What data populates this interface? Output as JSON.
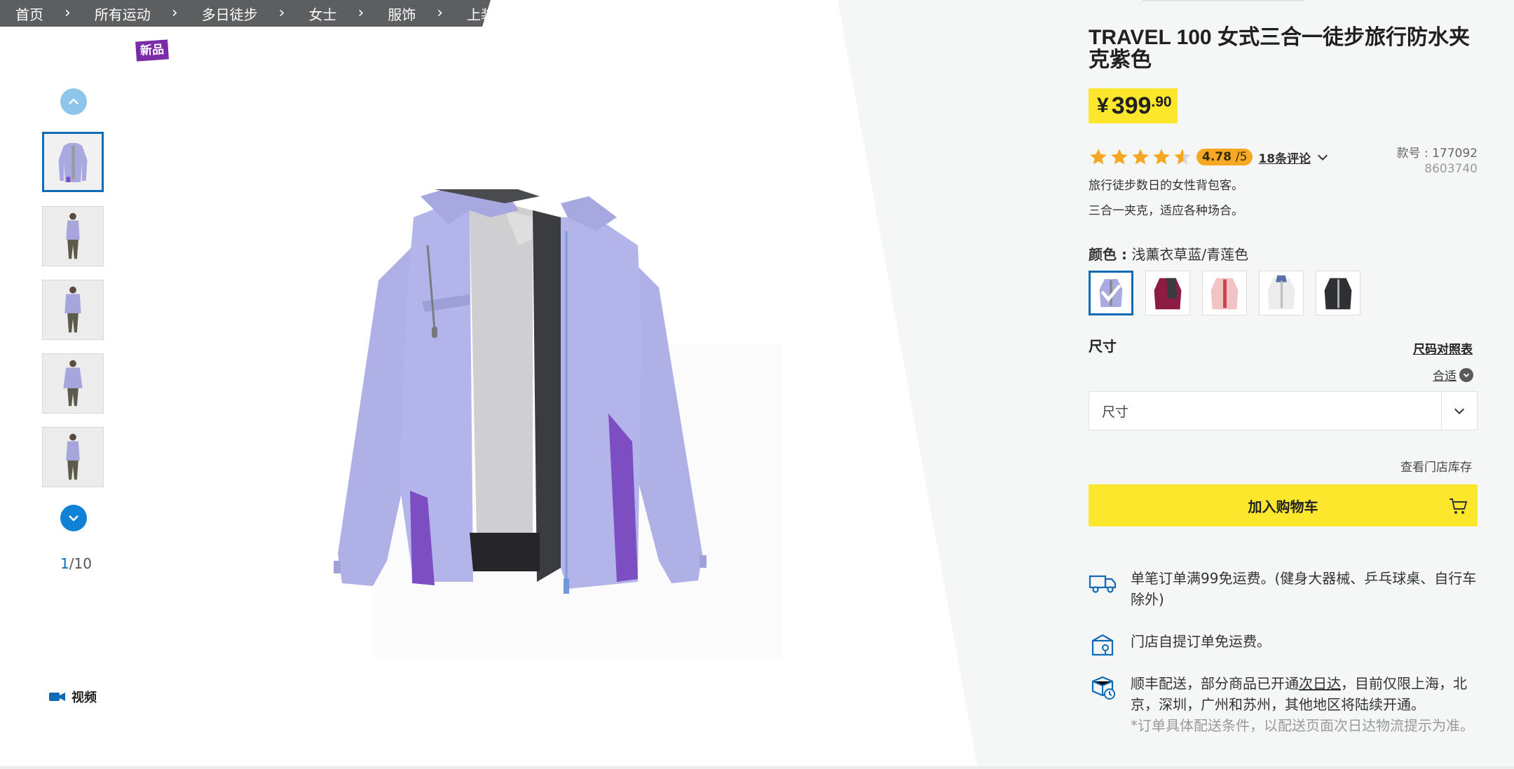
{
  "breadcrumb": [
    "首页",
    "所有运动",
    "多日徒步",
    "女士",
    "服饰",
    "上装"
  ],
  "badge": "新品",
  "gallery": {
    "current": "1",
    "separator": "/",
    "total": "10",
    "video_label": "视频"
  },
  "product": {
    "title": "TRAVEL 100 女式三合一徒步旅行防水夹克紫色",
    "price": {
      "currency": "¥",
      "integer": "399",
      "decimal": ".90"
    },
    "rating": {
      "value": "4.78",
      "scale": "/5",
      "stars": 4.78,
      "reviews_label": "18条评论"
    },
    "sku_label": "款号 : 177092",
    "sku_sub": "8603740",
    "desc1": "旅行徒步数日的女性背包客。",
    "desc2": "三合一夹克，适应各种场合。",
    "color_label": "颜色 :",
    "color_value": "浅薰衣草蓝/青莲色",
    "size_label": "尺寸",
    "size_chart": "尺码对照表",
    "fit_label": "合适",
    "size_placeholder": "尺寸",
    "store_stock": "查看门店库存",
    "add_to_cart": "加入购物车"
  },
  "shipping": [
    {
      "text": "单笔订单满99免运费。(健身大器械、乒乓球桌、自行车除外)",
      "icon": "truck-icon"
    },
    {
      "text": "门店自提订单免运费。",
      "icon": "store-pickup-icon"
    },
    {
      "text_a": "顺丰配送，部分商品已开通",
      "text_link": "次日达",
      "text_b": "，目前仅限上海，北京，深圳，广州和苏州，其他地区将陆续开通。",
      "note": "*订单具体配送条件，以配送页面次日达物流提示为准。",
      "icon": "fast-delivery-icon"
    }
  ],
  "colors": {
    "accent_yellow": "#fde72c",
    "brand_blue": "#0f6bb5",
    "rating_orange": "#f7a923",
    "star": "#f5a623"
  }
}
